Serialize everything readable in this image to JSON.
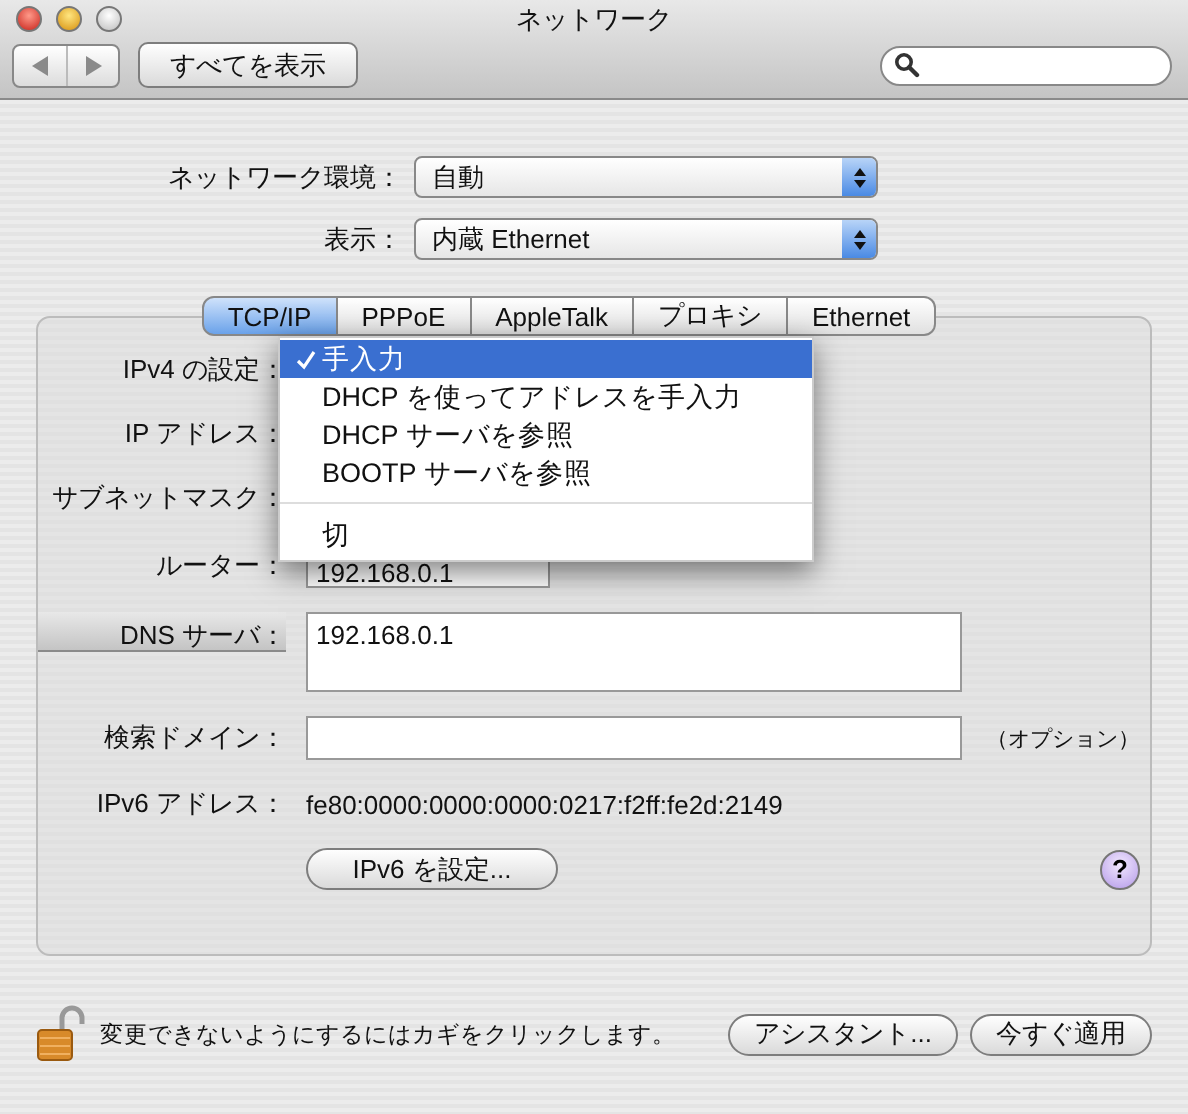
{
  "window": {
    "title": "ネットワーク"
  },
  "toolbar": {
    "show_all": "すべてを表示"
  },
  "location": {
    "label": "ネットワーク環境：",
    "value": "自動"
  },
  "show": {
    "label": "表示：",
    "value": "内蔵 Ethernet"
  },
  "tabs": [
    {
      "label": "TCP/IP",
      "selected": true
    },
    {
      "label": "PPPoE",
      "selected": false
    },
    {
      "label": "AppleTalk",
      "selected": false
    },
    {
      "label": "プロキシ",
      "selected": false
    },
    {
      "label": "Ethernet",
      "selected": false
    }
  ],
  "ipv4": {
    "label": "IPv4 の設定：",
    "menu": [
      {
        "kind": "item",
        "label": "手入力",
        "selected": true
      },
      {
        "kind": "item",
        "label": "DHCP を使ってアドレスを手入力",
        "selected": false
      },
      {
        "kind": "item",
        "label": "DHCP サーバを参照",
        "selected": false
      },
      {
        "kind": "item",
        "label": "BOOTP サーバを参照",
        "selected": false
      },
      {
        "kind": "separator"
      },
      {
        "kind": "item",
        "label": "切",
        "selected": false
      }
    ]
  },
  "ip_address": {
    "label": "IP アドレス："
  },
  "subnet_mask": {
    "label": "サブネットマスク："
  },
  "router": {
    "label": "ルーター：",
    "value": "192.168.0.1"
  },
  "dns": {
    "label": "DNS サーバ：",
    "value": "192.168.0.1"
  },
  "search_domain": {
    "label": "検索ドメイン：",
    "note": "（オプション）"
  },
  "ipv6": {
    "label": "IPv6 アドレス：",
    "value": "fe80:0000:0000:0000:0217:f2ff:fe2d:2149",
    "button": "IPv6 を設定..."
  },
  "help": "?",
  "footer": {
    "lock_text": "変更できないようにするにはカギをクリックします。",
    "buttons": [
      "アシスタント...",
      "今すぐ適用"
    ]
  }
}
